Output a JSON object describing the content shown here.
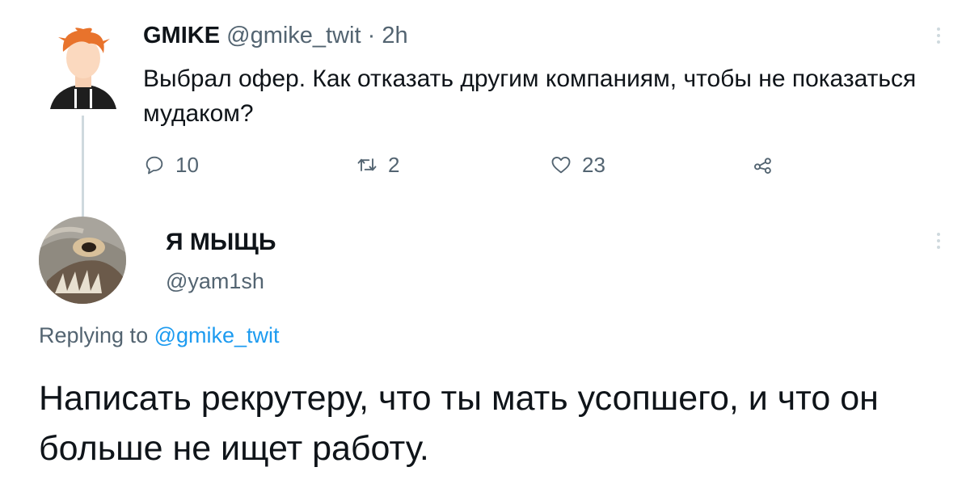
{
  "tweet": {
    "author_name": "GMIKE",
    "author_handle": "@gmike_twit",
    "separator": "·",
    "time": "2h",
    "text": "Выбрал офер. Как отказать другим компаниям, чтобы не показаться мудаком?",
    "actions": {
      "replies": "10",
      "retweets": "2",
      "likes": "23"
    },
    "icons": [
      "reply-icon",
      "retweet-icon",
      "like-icon",
      "share-icon",
      "more-icon"
    ]
  },
  "reply": {
    "author_name": "Я МЫЩЬ",
    "author_handle": "@yam1sh",
    "replying_prefix": "Replying to",
    "replying_handle": "@gmike_twit",
    "text": "Написать рекрутеру, что ты мать усопшего, и что он больше не ищет работу."
  },
  "colors": {
    "text": "#0f1419",
    "muted": "#536471",
    "link": "#1d9bf0",
    "thread_line": "#cfd9de"
  }
}
